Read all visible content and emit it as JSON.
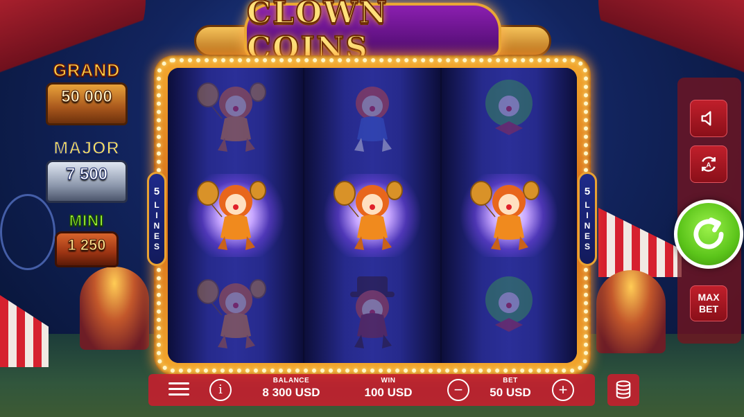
{
  "game": {
    "title": "CLOWN COINS"
  },
  "jackpots": {
    "grand": {
      "label": "GRAND",
      "value": "50 000"
    },
    "major": {
      "label": "MAJOR",
      "value": "7 500"
    },
    "mini": {
      "label": "MINI",
      "value": "1 250"
    }
  },
  "paylines": {
    "count": "5",
    "word": "LINES"
  },
  "reels": [
    [
      "clown-balloon",
      "clown-balloon",
      "clown-balloon"
    ],
    [
      "clown-juggler",
      "clown-balloon",
      "clown-top-hat"
    ],
    [
      "clown-green-hair",
      "clown-balloon",
      "clown-green-hair"
    ]
  ],
  "win_row": 1,
  "controls": {
    "max_bet_line1": "MAX",
    "max_bet_line2": "BET",
    "icons": {
      "sound": "speaker-icon",
      "autoplay": "autoplay-icon",
      "spin": "spin-icon",
      "menu": "menu-icon",
      "info": "info-icon",
      "minus": "minus-icon",
      "plus": "plus-icon",
      "coins": "coin-stack-icon"
    }
  },
  "bottom": {
    "balance_label": "BALANCE",
    "balance_value": "8 300 USD",
    "win_label": "WIN",
    "win_value": "100 USD",
    "bet_label": "BET",
    "bet_value": "50 USD"
  },
  "colors": {
    "spin_green": "#5bc41a",
    "button_red": "#c01f2b",
    "frame_gold": "#f3a92e",
    "reel_blue": "#262a8c"
  }
}
